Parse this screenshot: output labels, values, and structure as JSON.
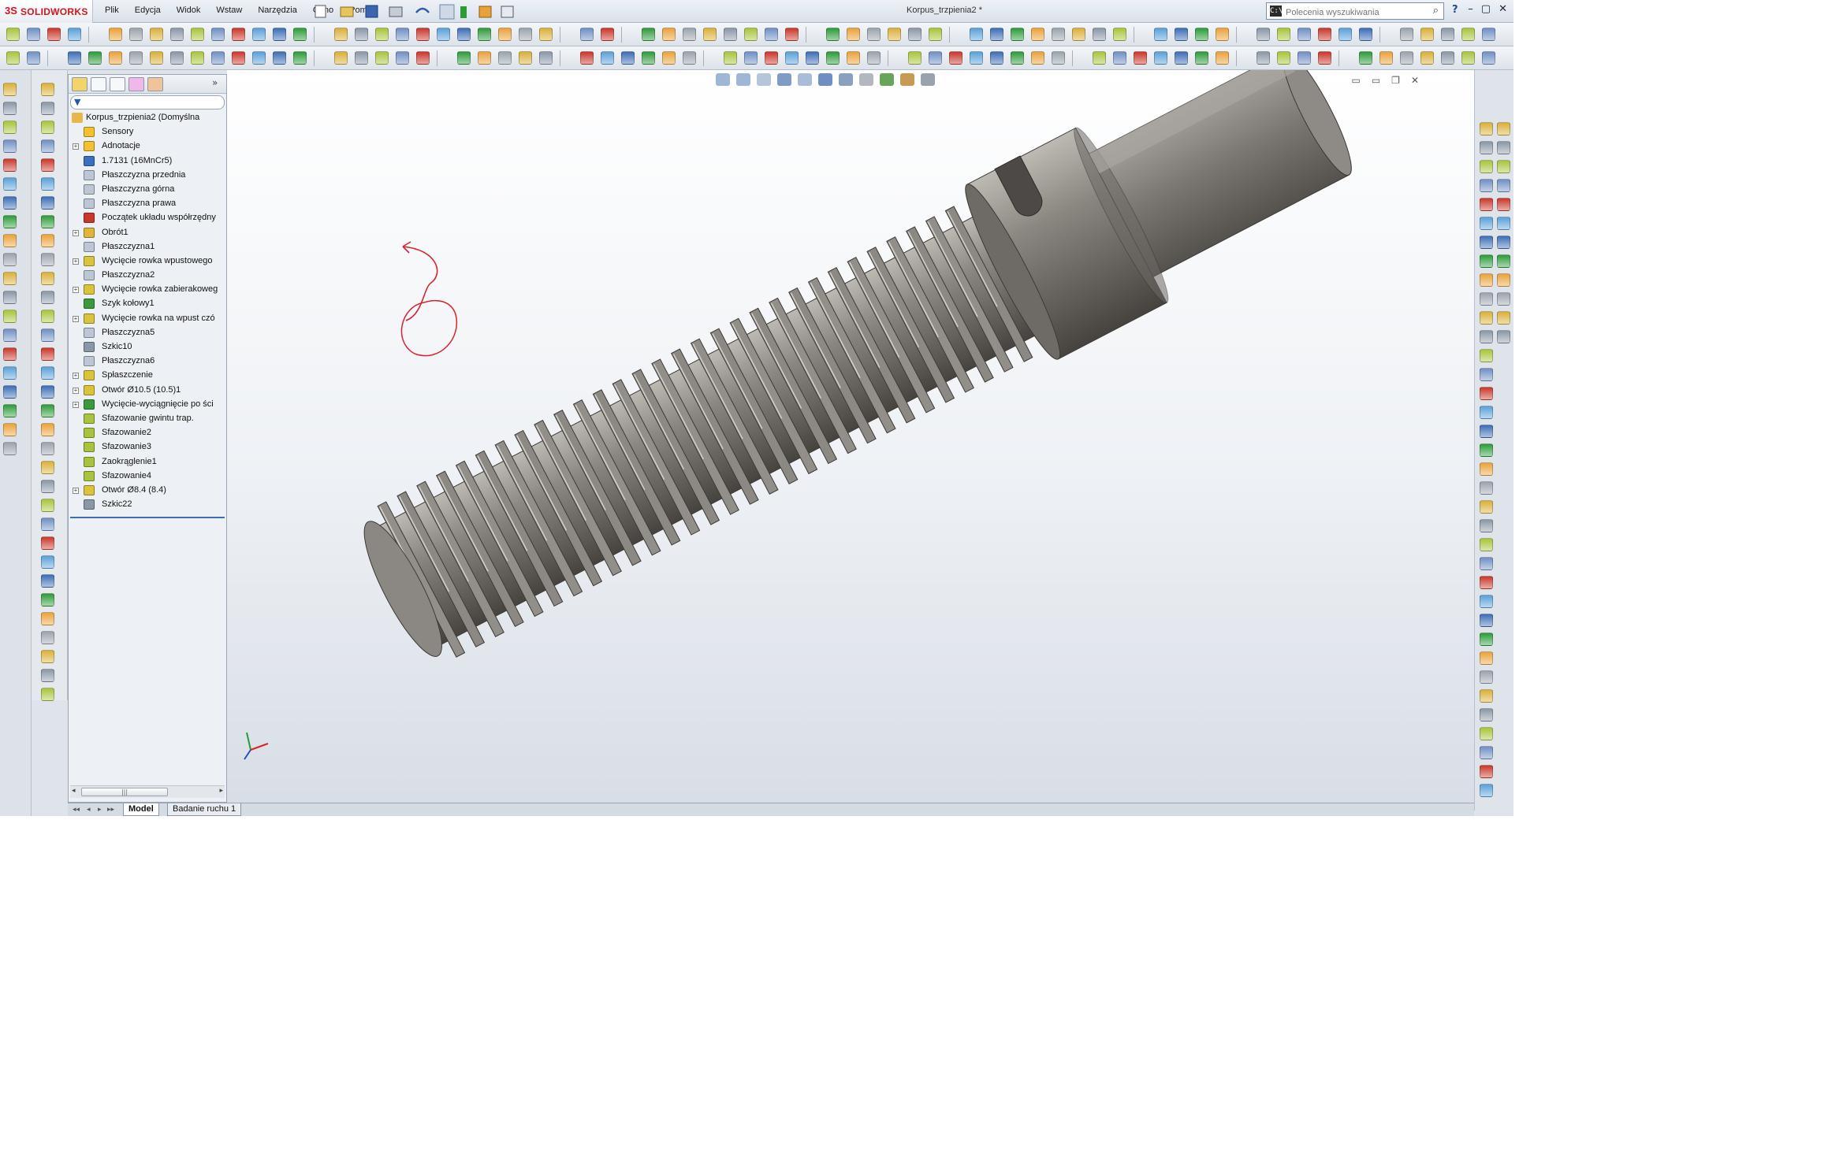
{
  "app": {
    "brand_ds": "3S",
    "brand_name": "SOLIDWORKS",
    "document_title": "Korpus_trzpienia2 *",
    "menu": [
      "Plik",
      "Edycja",
      "Widok",
      "Wstaw",
      "Narzędzia",
      "Okno",
      "Pomoc"
    ],
    "search_placeholder": "Polecenia wyszukiwania",
    "search_cmd_glyph": "C:\\",
    "help_glyph": "?",
    "window_controls": [
      "–",
      "▢",
      "✕"
    ]
  },
  "feature_tree": {
    "root": "Korpus_trzpienia2  (Domyślna",
    "items": [
      {
        "label": "Sensory",
        "expand": false,
        "icon": "sensors-icon",
        "color": "#f2c230"
      },
      {
        "label": "Adnotacje",
        "expand": true,
        "icon": "annotations-icon",
        "color": "#f2c230"
      },
      {
        "label": "1.7131 (16MnCr5)",
        "expand": false,
        "icon": "material-icon",
        "color": "#3a6fc1"
      },
      {
        "label": "Płaszczyzna przednia",
        "expand": false,
        "icon": "plane-icon",
        "color": "#bcc6d4"
      },
      {
        "label": "Płaszczyzna górna",
        "expand": false,
        "icon": "plane-icon",
        "color": "#bcc6d4"
      },
      {
        "label": "Płaszczyzna prawa",
        "expand": false,
        "icon": "plane-icon",
        "color": "#bcc6d4"
      },
      {
        "label": "Początek układu współrzędny",
        "expand": false,
        "icon": "origin-icon",
        "color": "#c9372c"
      },
      {
        "label": "Obrót1",
        "expand": true,
        "icon": "revolve-icon",
        "color": "#e0b63a"
      },
      {
        "label": "Płaszczyzna1",
        "expand": false,
        "icon": "plane-icon",
        "color": "#bcc6d4"
      },
      {
        "label": "Wycięcie rowka wpustowego",
        "expand": true,
        "icon": "cut-extrude-icon",
        "color": "#d9c43c"
      },
      {
        "label": "Płaszczyzna2",
        "expand": false,
        "icon": "plane-icon",
        "color": "#bcc6d4"
      },
      {
        "label": "Wycięcie rowka zabierakoweg",
        "expand": true,
        "icon": "cut-extrude-icon",
        "color": "#d9c43c"
      },
      {
        "label": "Szyk kołowy1",
        "expand": false,
        "icon": "circular-pattern-icon",
        "color": "#3c9a3c"
      },
      {
        "label": "Wycięcie rowka na wpust czó",
        "expand": true,
        "icon": "cut-extrude-icon",
        "color": "#d9c43c"
      },
      {
        "label": "Płaszczyzna5",
        "expand": false,
        "icon": "plane-icon",
        "color": "#bcc6d4"
      },
      {
        "label": "Szkic10",
        "expand": false,
        "icon": "sketch-icon",
        "color": "#8a97a8"
      },
      {
        "label": "Płaszczyzna6",
        "expand": false,
        "icon": "plane-icon",
        "color": "#bcc6d4"
      },
      {
        "label": "Spłaszczenie",
        "expand": true,
        "icon": "cut-extrude-icon",
        "color": "#d9c43c"
      },
      {
        "label": "Otwór Ø10.5 (10.5)1",
        "expand": true,
        "icon": "hole-icon",
        "color": "#d9c43c"
      },
      {
        "label": "Wycięcie-wyciągnięcie po ści",
        "expand": true,
        "icon": "sweep-cut-icon",
        "color": "#3c9a3c"
      },
      {
        "label": "Sfazowanie gwintu trap.",
        "expand": false,
        "icon": "chamfer-icon",
        "color": "#a8c43c"
      },
      {
        "label": "Sfazowanie2",
        "expand": false,
        "icon": "chamfer-icon",
        "color": "#a8c43c"
      },
      {
        "label": "Sfazowanie3",
        "expand": false,
        "icon": "chamfer-icon",
        "color": "#a8c43c"
      },
      {
        "label": "Zaokrąglenie1",
        "expand": false,
        "icon": "fillet-icon",
        "color": "#a8c43c"
      },
      {
        "label": "Sfazowanie4",
        "expand": false,
        "icon": "chamfer-icon",
        "color": "#a8c43c"
      },
      {
        "label": "Otwór Ø8.4 (8.4)",
        "expand": true,
        "icon": "hole-icon",
        "color": "#d9c43c"
      },
      {
        "label": "Szkic22",
        "expand": false,
        "icon": "sketch-icon",
        "color": "#8a97a8"
      }
    ]
  },
  "bottom_tabs": {
    "model": "Model",
    "motion": "Badanie ruchu 1"
  },
  "colors": {
    "part_body": "#7e7a75",
    "part_highlight": "#b7b3ad",
    "part_shadow": "#45423f",
    "markup_red": "#d9232c",
    "accent_blue": "#3d6db5"
  }
}
